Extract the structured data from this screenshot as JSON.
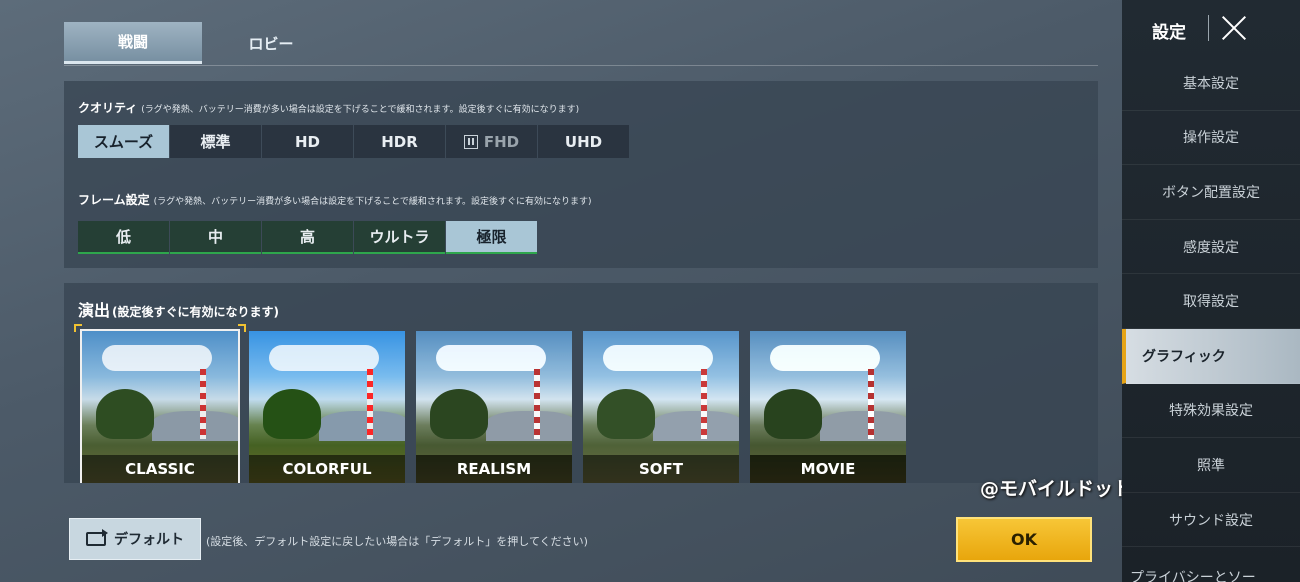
{
  "tabs": [
    {
      "label": "戦闘",
      "active": true
    },
    {
      "label": "ロビー",
      "active": false
    }
  ],
  "quality": {
    "label": "クオリティ",
    "note": "(ラグや発熱、バッテリー消費が多い場合は設定を下げることで緩和されます。設定後すぐに有効になります)",
    "options": [
      "スムーズ",
      "標準",
      "HD",
      "HDR",
      "FHD",
      "UHD"
    ],
    "selected": "スムーズ"
  },
  "frame": {
    "label": "フレーム設定",
    "note": "(ラグや発熱、バッテリー消費が多い場合は設定を下げることで緩和されます。設定後すぐに有効になります)",
    "options": [
      "低",
      "中",
      "高",
      "ウルトラ",
      "極限"
    ],
    "selected": "極限"
  },
  "style": {
    "label": "演出",
    "note": "(設定後すぐに有効になります)",
    "options": [
      "CLASSIC",
      "COLORFUL",
      "REALISM",
      "SOFT",
      "MOVIE"
    ],
    "selected": "CLASSIC"
  },
  "footer": {
    "default_label": "デフォルト",
    "default_note": "(設定後、デフォルト設定に戻したい場合は「デフォルト」を押してください)",
    "ok_label": "OK"
  },
  "watermark": "@モバイルドットコム",
  "sidebar": {
    "title": "設定",
    "items": [
      "基本設定",
      "操作設定",
      "ボタン配置設定",
      "感度設定",
      "取得設定",
      "グラフィック",
      "特殊効果設定",
      "照準",
      "サウンド設定",
      "プライバシーとソー"
    ],
    "active": "グラフィック"
  },
  "colors": {
    "accent_gold": "#f1c232",
    "selected_option": "#a9c6d6",
    "frame_green": "#2ea64c"
  }
}
